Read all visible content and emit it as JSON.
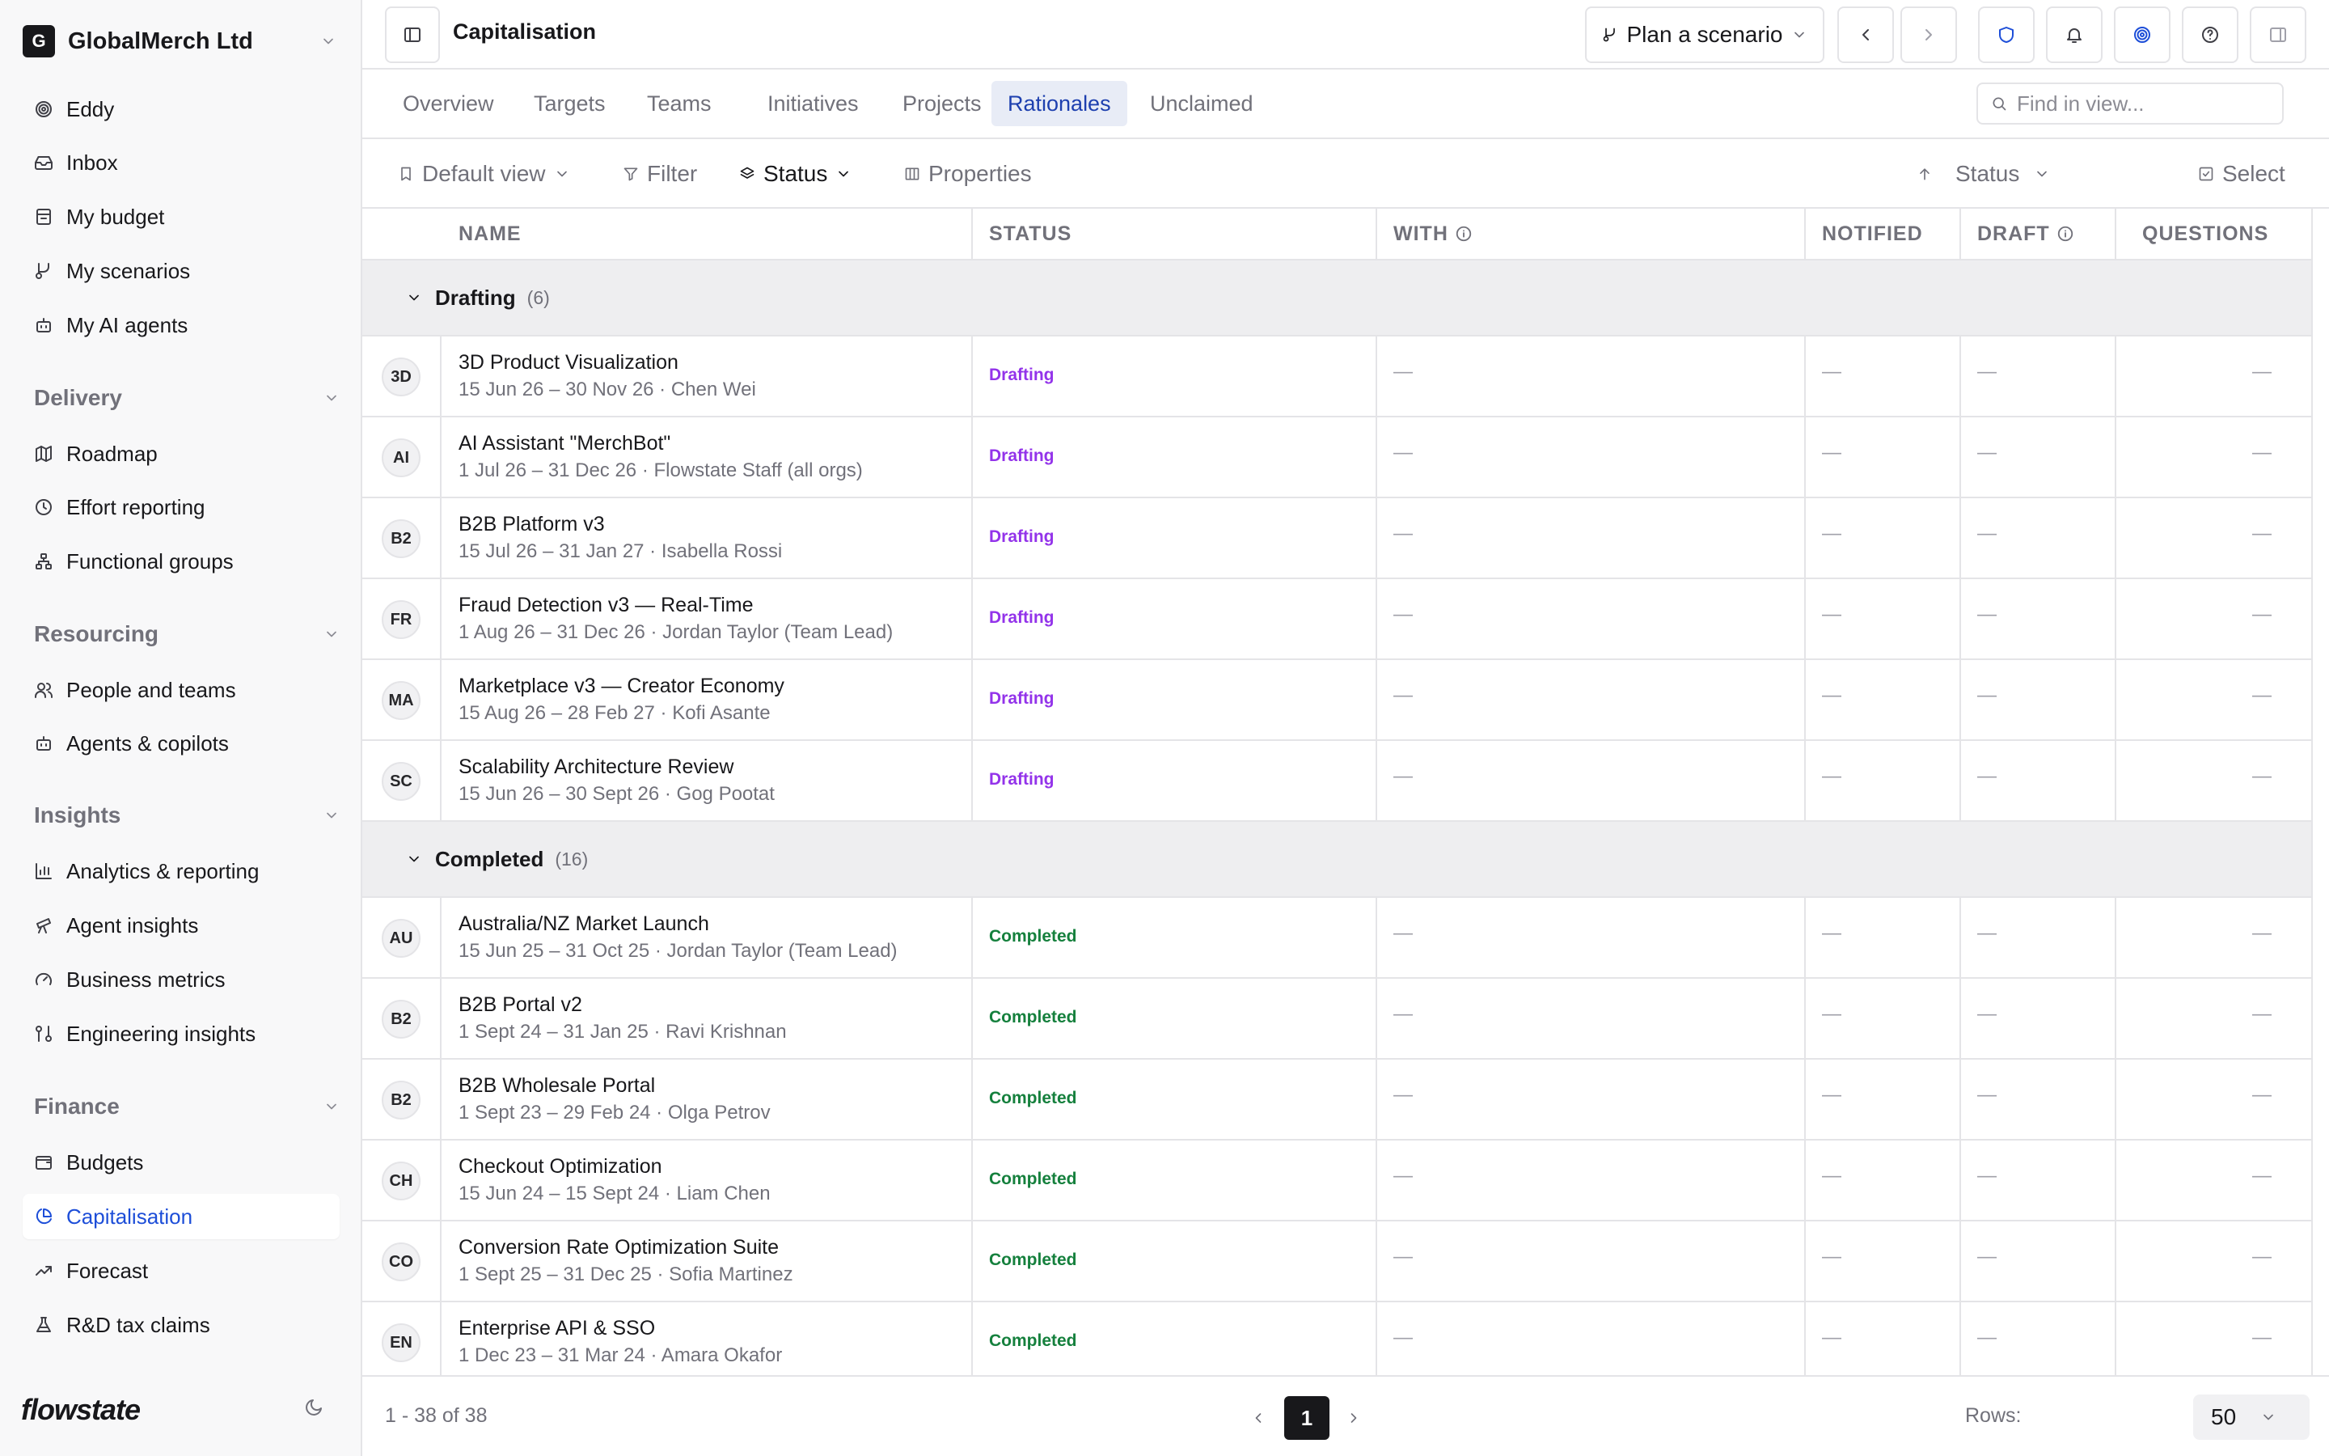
{
  "org": {
    "logo": "G",
    "name": "GlobalMerch Ltd"
  },
  "sidebar": {
    "top_items": [
      {
        "label": "Eddy",
        "icon": "spiral-icon"
      },
      {
        "label": "Inbox",
        "icon": "inbox-icon"
      },
      {
        "label": "My budget",
        "icon": "budget-icon"
      },
      {
        "label": "My scenarios",
        "icon": "branch-icon"
      },
      {
        "label": "My AI agents",
        "icon": "bot-icon"
      }
    ],
    "sections": [
      {
        "title": "Delivery",
        "items": [
          {
            "label": "Roadmap",
            "icon": "map-icon"
          },
          {
            "label": "Effort reporting",
            "icon": "clock-icon"
          },
          {
            "label": "Functional groups",
            "icon": "hierarchy-icon"
          }
        ]
      },
      {
        "title": "Resourcing",
        "items": [
          {
            "label": "People and teams",
            "icon": "users-icon"
          },
          {
            "label": "Agents & copilots",
            "icon": "bot-icon"
          }
        ]
      },
      {
        "title": "Insights",
        "items": [
          {
            "label": "Analytics & reporting",
            "icon": "bar-chart-icon"
          },
          {
            "label": "Agent insights",
            "icon": "telescope-icon"
          },
          {
            "label": "Business metrics",
            "icon": "gauge-icon"
          },
          {
            "label": "Engineering insights",
            "icon": "git-compare-icon"
          }
        ]
      },
      {
        "title": "Finance",
        "items": [
          {
            "label": "Budgets",
            "icon": "wallet-icon"
          },
          {
            "label": "Capitalisation",
            "icon": "pie-chart-icon",
            "active": true
          },
          {
            "label": "Forecast",
            "icon": "trending-up-icon"
          },
          {
            "label": "R&D tax claims",
            "icon": "flask-icon"
          }
        ]
      }
    ],
    "brand": "flowstate"
  },
  "header": {
    "title": "Capitalisation",
    "scenario_label": "Plan a scenario"
  },
  "tabs": [
    "Overview",
    "Targets",
    "Teams",
    "Initiatives",
    "Projects",
    "Rationales",
    "Unclaimed"
  ],
  "active_tab": "Rationales",
  "search": {
    "placeholder": "Find in view..."
  },
  "toolbar": {
    "view": "Default view",
    "filter": "Filter",
    "group": "Status",
    "properties": "Properties",
    "sort": "Status",
    "select": "Select"
  },
  "table": {
    "columns": [
      "NAME",
      "STATUS",
      "WITH",
      "NOTIFIED",
      "DRAFT",
      "QUESTIONS"
    ],
    "empty": "—",
    "groups": [
      {
        "label": "Drafting",
        "count": "(6)",
        "rows": [
          {
            "abbr": "3D",
            "name": "3D Product Visualization",
            "meta": "15 Jun 26 – 30 Nov 26 · Chen Wei",
            "status": "Drafting"
          },
          {
            "abbr": "AI",
            "name": "AI Assistant \"MerchBot\"",
            "meta": "1 Jul 26 – 31 Dec 26 · Flowstate Staff (all orgs)",
            "status": "Drafting"
          },
          {
            "abbr": "B2",
            "name": "B2B Platform v3",
            "meta": "15 Jul 26 – 31 Jan 27 · Isabella Rossi",
            "status": "Drafting"
          },
          {
            "abbr": "FR",
            "name": "Fraud Detection v3 — Real-Time",
            "meta": "1 Aug 26 – 31 Dec 26 · Jordan Taylor (Team Lead)",
            "status": "Drafting"
          },
          {
            "abbr": "MA",
            "name": "Marketplace v3 — Creator Economy",
            "meta": "15 Aug 26 – 28 Feb 27 · Kofi Asante",
            "status": "Drafting"
          },
          {
            "abbr": "SC",
            "name": "Scalability Architecture Review",
            "meta": "15 Jun 26 – 30 Sept 26 · Gog Pootat",
            "status": "Drafting"
          }
        ]
      },
      {
        "label": "Completed",
        "count": "(16)",
        "rows": [
          {
            "abbr": "AU",
            "name": "Australia/NZ Market Launch",
            "meta": "15 Jun 25 – 31 Oct 25 · Jordan Taylor (Team Lead)",
            "status": "Completed"
          },
          {
            "abbr": "B2",
            "name": "B2B Portal v2",
            "meta": "1 Sept 24 – 31 Jan 25 · Ravi Krishnan",
            "status": "Completed"
          },
          {
            "abbr": "B2",
            "name": "B2B Wholesale Portal",
            "meta": "1 Sept 23 – 29 Feb 24 · Olga Petrov",
            "status": "Completed"
          },
          {
            "abbr": "CH",
            "name": "Checkout Optimization",
            "meta": "15 Jun 24 – 15 Sept 24 · Liam Chen",
            "status": "Completed"
          },
          {
            "abbr": "CO",
            "name": "Conversion Rate Optimization Suite",
            "meta": "1 Sept 25 – 31 Dec 25 · Sofia Martinez",
            "status": "Completed"
          },
          {
            "abbr": "EN",
            "name": "Enterprise API & SSO",
            "meta": "1 Dec 23 – 31 Mar 24 · Amara Okafor",
            "status": "Completed"
          }
        ]
      }
    ]
  },
  "footer": {
    "range": "1 - 38 of 38",
    "page": "1",
    "rows_label": "Rows:",
    "rows_value": "50"
  },
  "colors": {
    "accent": "#1d4ed8",
    "drafting": "#9333ea",
    "completed": "#15803d"
  }
}
